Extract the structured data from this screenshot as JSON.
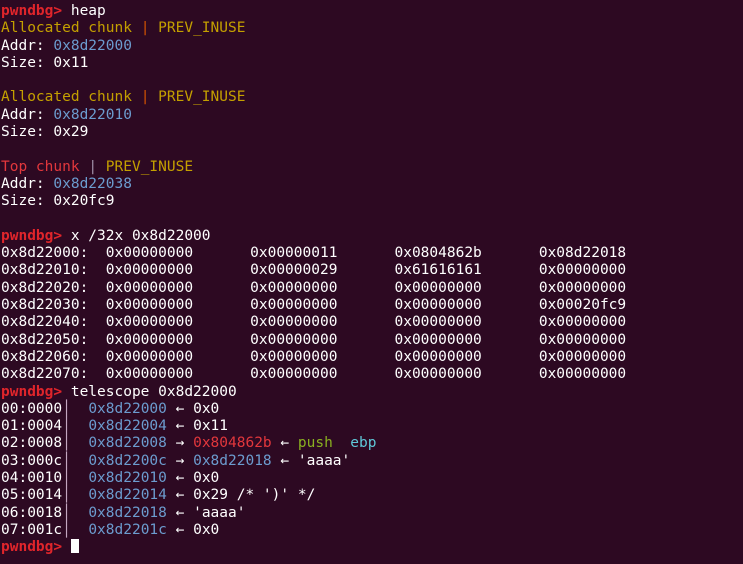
{
  "terminal": {
    "background_color": "#2d0922",
    "foreground_color": "#ffffff",
    "prompt": "pwndbg>",
    "colors": {
      "prompt_red": "#e0252b",
      "chunk_yellow": "#c4a000",
      "separator_orange": "#d35400",
      "top_chunk_red": "#e2373c",
      "address_blue": "#6c9ccf",
      "mnemonic_green": "#8ab020",
      "register_cyan": "#5fc8d8",
      "telescope_bar": "#c3a6c0"
    }
  },
  "commands": {
    "heap": "heap",
    "examine": "x /32x 0x8d22000",
    "telescope": "telescope 0x8d22000"
  },
  "heap": {
    "chunks": [
      {
        "type": "Allocated chunk",
        "type_color": "chunk_yellow",
        "separator": "|",
        "flags": "PREV_INUSE",
        "addr_label": "Addr:",
        "addr": "0x8d22000",
        "size_label": "Size:",
        "size": "0x11"
      },
      {
        "type": "Allocated chunk",
        "type_color": "chunk_yellow",
        "separator": "|",
        "flags": "PREV_INUSE",
        "addr_label": "Addr:",
        "addr": "0x8d22010",
        "size_label": "Size:",
        "size": "0x29"
      },
      {
        "type": "Top chunk",
        "type_color": "top_chunk_red",
        "separator": "|",
        "flags": "PREV_INUSE",
        "addr_label": "Addr:",
        "addr": "0x8d22038",
        "size_label": "Size:",
        "size": "0x20fc9"
      }
    ]
  },
  "memory_dump": {
    "format": "x /32x",
    "base": "0x8d22000",
    "rows": [
      {
        "addr": "0x8d22000:",
        "words": [
          "0x00000000",
          "0x00000011",
          "0x0804862b",
          "0x08d22018"
        ]
      },
      {
        "addr": "0x8d22010:",
        "words": [
          "0x00000000",
          "0x00000029",
          "0x61616161",
          "0x00000000"
        ]
      },
      {
        "addr": "0x8d22020:",
        "words": [
          "0x00000000",
          "0x00000000",
          "0x00000000",
          "0x00000000"
        ]
      },
      {
        "addr": "0x8d22030:",
        "words": [
          "0x00000000",
          "0x00000000",
          "0x00000000",
          "0x00020fc9"
        ]
      },
      {
        "addr": "0x8d22040:",
        "words": [
          "0x00000000",
          "0x00000000",
          "0x00000000",
          "0x00000000"
        ]
      },
      {
        "addr": "0x8d22050:",
        "words": [
          "0x00000000",
          "0x00000000",
          "0x00000000",
          "0x00000000"
        ]
      },
      {
        "addr": "0x8d22060:",
        "words": [
          "0x00000000",
          "0x00000000",
          "0x00000000",
          "0x00000000"
        ]
      },
      {
        "addr": "0x8d22070:",
        "words": [
          "0x00000000",
          "0x00000000",
          "0x00000000",
          "0x00000000"
        ]
      }
    ]
  },
  "telescope": {
    "base": "0x8d22000",
    "rows": [
      {
        "index": "00:0000",
        "addr": "0x8d22000",
        "arrow1": "←",
        "value": "0x0",
        "value_color": "white",
        "arrow2": "",
        "disasm_mnemonic": "",
        "disasm_operand": "",
        "deref_addr": "",
        "deref_arrow": "",
        "comment": ""
      },
      {
        "index": "01:0004",
        "addr": "0x8d22004",
        "arrow1": "←",
        "value": "0x11",
        "value_color": "white",
        "arrow2": "",
        "disasm_mnemonic": "",
        "disasm_operand": "",
        "deref_addr": "",
        "deref_arrow": "",
        "comment": ""
      },
      {
        "index": "02:0008",
        "addr": "0x8d22008",
        "arrow1": "→",
        "value": "0x804862b",
        "value_color": "red",
        "arrow2": "←",
        "disasm_mnemonic": "push",
        "disasm_operand": "ebp",
        "deref_addr": "",
        "deref_arrow": "",
        "comment": ""
      },
      {
        "index": "03:000c",
        "addr": "0x8d2200c",
        "arrow1": "→",
        "value": "0x8d22018",
        "value_color": "blue",
        "arrow2": "←",
        "disasm_mnemonic": "",
        "disasm_operand": "",
        "deref_addr": "",
        "deref_arrow": "",
        "comment": "'aaaa'"
      },
      {
        "index": "04:0010",
        "addr": "0x8d22010",
        "arrow1": "←",
        "value": "0x0",
        "value_color": "white",
        "arrow2": "",
        "disasm_mnemonic": "",
        "disasm_operand": "",
        "deref_addr": "",
        "deref_arrow": "",
        "comment": ""
      },
      {
        "index": "05:0014",
        "addr": "0x8d22014",
        "arrow1": "←",
        "value": "0x29 /* ')' */",
        "value_color": "white",
        "arrow2": "",
        "disasm_mnemonic": "",
        "disasm_operand": "",
        "deref_addr": "",
        "deref_arrow": "",
        "comment": ""
      },
      {
        "index": "06:0018",
        "addr": "0x8d22018",
        "arrow1": "←",
        "value": "'aaaa'",
        "value_color": "white",
        "arrow2": "",
        "disasm_mnemonic": "",
        "disasm_operand": "",
        "deref_addr": "",
        "deref_arrow": "",
        "comment": ""
      },
      {
        "index": "07:001c",
        "addr": "0x8d2201c",
        "arrow1": "←",
        "value": "0x0",
        "value_color": "white",
        "arrow2": "",
        "disasm_mnemonic": "",
        "disasm_operand": "",
        "deref_addr": "",
        "deref_arrow": "",
        "comment": ""
      }
    ]
  },
  "final_prompt": {
    "prompt": "pwndbg>",
    "input": "",
    "cursor": true
  }
}
